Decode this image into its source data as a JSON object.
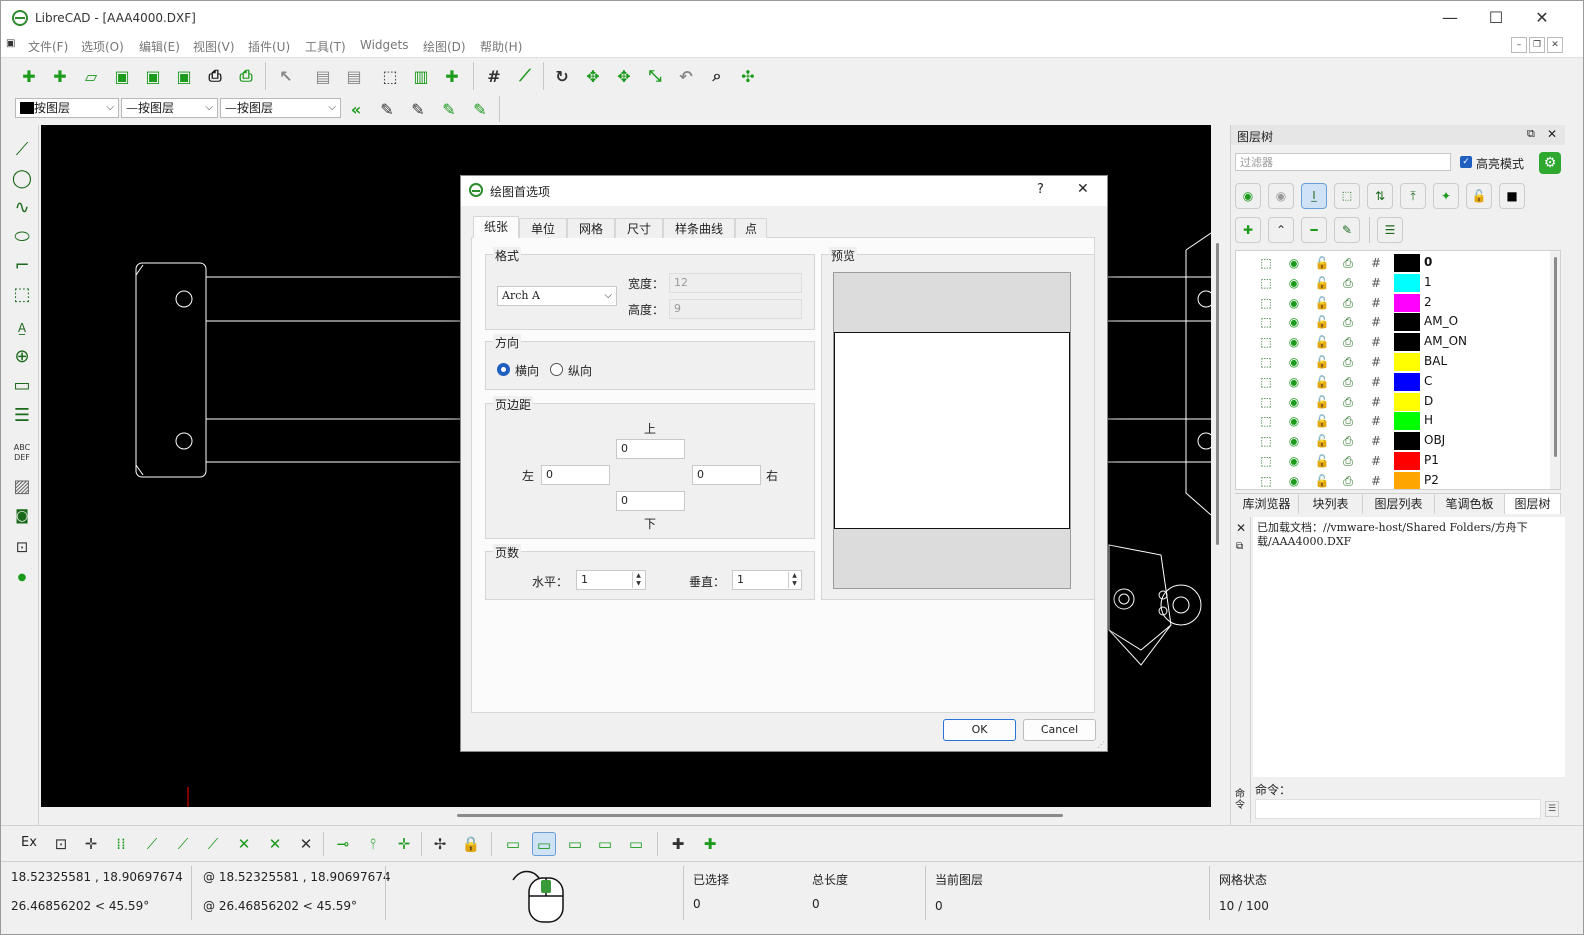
{
  "window": {
    "title": "LibreCAD - [AAA4000.DXF]",
    "minimize": "—",
    "maximize": "☐",
    "close": "✕"
  },
  "menu": {
    "items": [
      "文件(F)",
      "选项(O)",
      "编辑(E)",
      "视图(V)",
      "插件(U)",
      "工具(T)",
      "Widgets",
      "绘图(D)",
      "帮助(H)"
    ]
  },
  "pen_toolbar": {
    "color": "按图层",
    "linetype": "按图层",
    "width": "按图层"
  },
  "dialog": {
    "title": "绘图首选项",
    "help": "?",
    "close": "✕",
    "tabs": [
      "纸张",
      "单位",
      "网格",
      "尺寸",
      "样条曲线",
      "点"
    ],
    "format": {
      "label": "格式",
      "value": "Arch A",
      "width_label": "宽度：",
      "width": "12",
      "height_label": "高度：",
      "height": "9"
    },
    "orientation": {
      "label": "方向",
      "landscape": "横向",
      "portrait": "纵向"
    },
    "margins": {
      "label": "页边距",
      "top_label": "上",
      "top": "0",
      "left_label": "左",
      "left": "0",
      "right_label": "右",
      "right": "0",
      "bottom_label": "下",
      "bottom": "0"
    },
    "pages": {
      "label": "页数",
      "h_label": "水平：",
      "h": "1",
      "v_label": "垂直：",
      "v": "1"
    },
    "preview": {
      "label": "预览"
    },
    "ok": "OK",
    "cancel": "Cancel"
  },
  "layer_panel": {
    "title": "图层树",
    "filter_placeholder": "过滤器",
    "highlight": "高亮模式",
    "layers": [
      {
        "name": "0",
        "color": "#000000"
      },
      {
        "name": "1",
        "color": "#00ffff"
      },
      {
        "name": "2",
        "color": "#ff00ff"
      },
      {
        "name": "AM_O",
        "color": "#000000"
      },
      {
        "name": "AM_ON",
        "color": "#000000"
      },
      {
        "name": "BAL",
        "color": "#ffff00"
      },
      {
        "name": "C",
        "color": "#0000ff"
      },
      {
        "name": "D",
        "color": "#ffff00"
      },
      {
        "name": "H",
        "color": "#00ff00"
      },
      {
        "name": "OBJ",
        "color": "#000000"
      },
      {
        "name": "P1",
        "color": "#ff0000"
      },
      {
        "name": "P2",
        "color": "#ffa500"
      }
    ],
    "tabs": [
      "库浏览器",
      "块列表",
      "图层列表",
      "笔调色板",
      "图层树"
    ]
  },
  "command": {
    "history": "已加载文档：//vmware-host/Shared Folders/方舟下载/AAA4000.DXF",
    "label": "命令：",
    "side": "命令"
  },
  "bottom_toolbar": {
    "ex": "Ex"
  },
  "status": {
    "abs_coord": "18.52325581 , 18.90697674",
    "abs_polar": "26.46856202 < 45.59°",
    "rel_coord": "@  18.52325581 , 18.90697674",
    "rel_polar": "@  26.46856202 < 45.59°",
    "selected_label": "已选择",
    "selected": "0",
    "length_label": "总长度",
    "length": "0",
    "layer_label": "当前图层",
    "layer": "0",
    "grid_label": "网格状态",
    "grid": "10 / 100"
  }
}
